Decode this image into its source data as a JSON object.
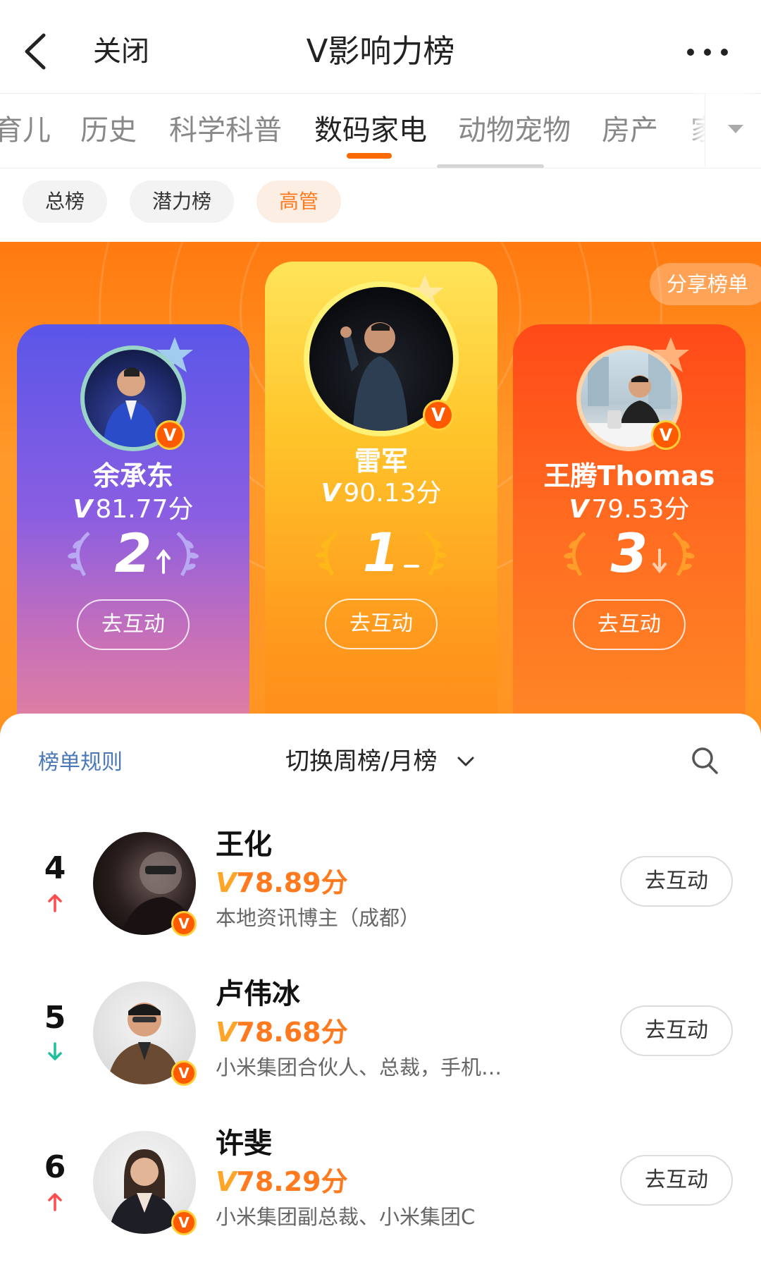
{
  "topbar": {
    "close_label": "关闭",
    "title": "V影响力榜"
  },
  "category_tabs": [
    {
      "label": "育儿"
    },
    {
      "label": "历史"
    },
    {
      "label": "科学科普"
    },
    {
      "label": "数码家电",
      "active": true
    },
    {
      "label": "动物宠物"
    },
    {
      "label": "房产"
    },
    {
      "label": "家"
    }
  ],
  "sub_tabs": [
    {
      "label": "总榜"
    },
    {
      "label": "潜力榜"
    },
    {
      "label": "高管",
      "active": true
    }
  ],
  "hero": {
    "share_label": "分享榜单",
    "top3": [
      {
        "rank": "2",
        "name": "余承东",
        "score": "81.77分",
        "trend": "up",
        "button": "去互动"
      },
      {
        "rank": "1",
        "name": "雷军",
        "score": "90.13分",
        "trend": "same",
        "button": "去互动"
      },
      {
        "rank": "3",
        "name": "王腾Thomas",
        "score": "79.53分",
        "trend": "down",
        "button": "去互动"
      }
    ]
  },
  "panel": {
    "rule_label": "榜单规则",
    "switch_label": "切换周榜/月榜"
  },
  "list": [
    {
      "rank": "4",
      "trend": "up",
      "name": "王化",
      "score": "78.89分",
      "desc": "本地资讯博主（成都）",
      "button": "去互动"
    },
    {
      "rank": "5",
      "trend": "down",
      "name": "卢伟冰",
      "score": "78.68分",
      "desc": "小米集团合伙人、总裁，手机…",
      "button": "去互动"
    },
    {
      "rank": "6",
      "trend": "up",
      "name": "许斐",
      "score": "78.29分",
      "desc": "小米集团副总裁、小米集团C",
      "button": "去互动"
    }
  ],
  "colors": {
    "accent": "#ff7a1e",
    "up": "#ff4d4f",
    "down": "#1fbf9c",
    "link": "#4a78b8"
  },
  "v_mark": "V"
}
